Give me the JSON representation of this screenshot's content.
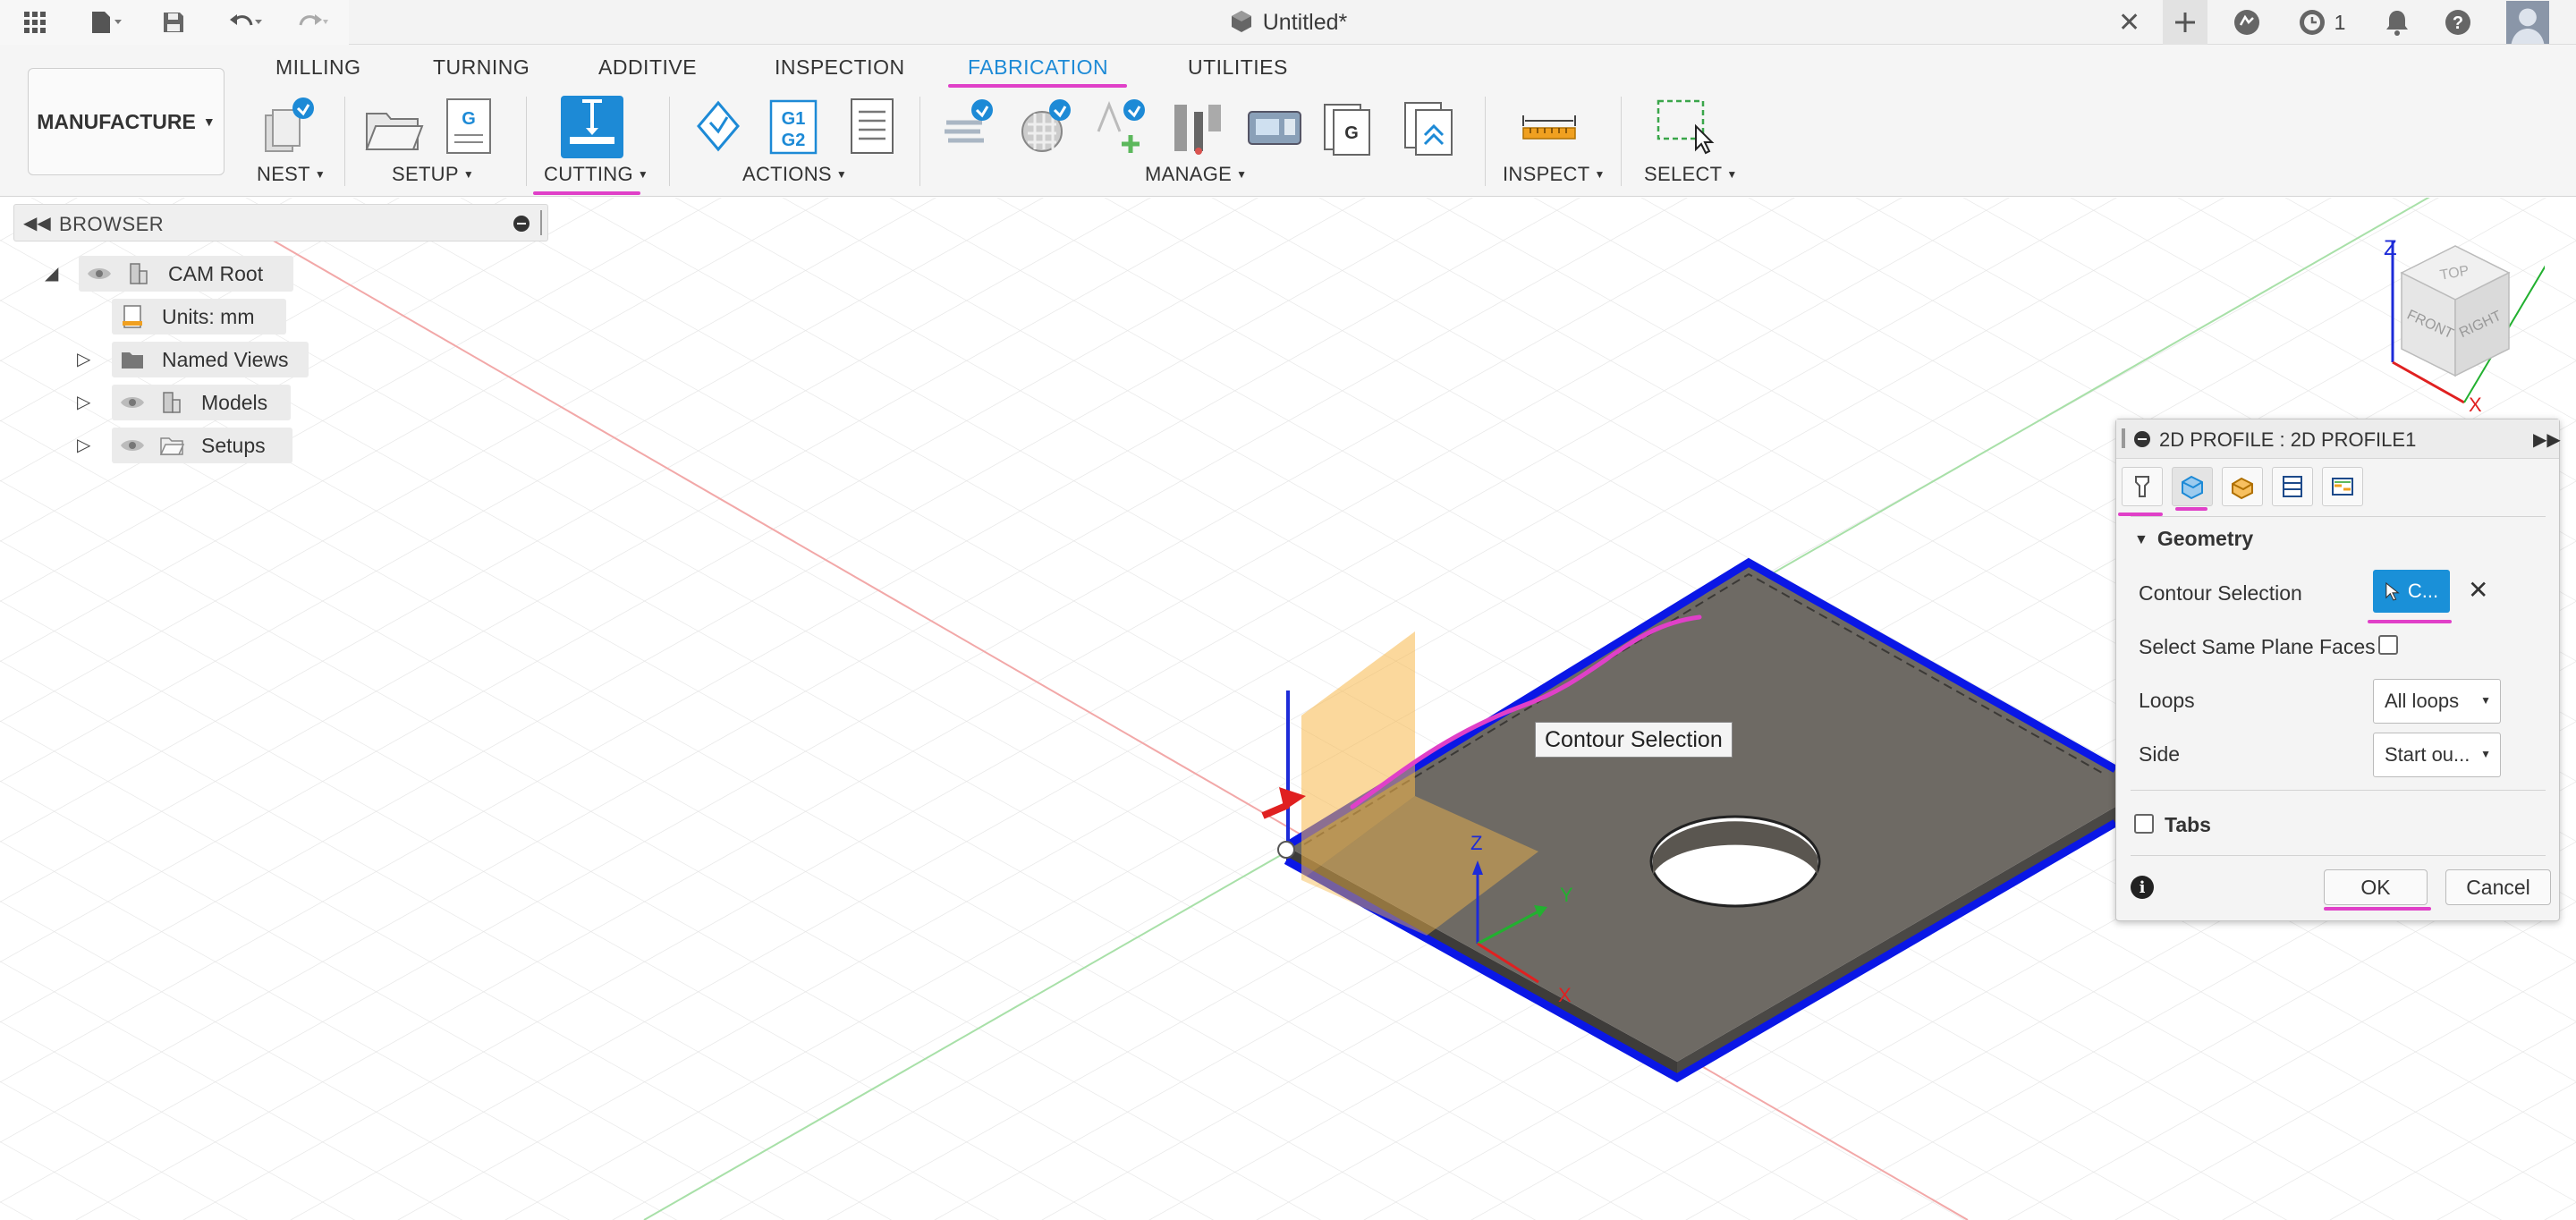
{
  "titlebar": {
    "document_title": "Untitled*",
    "notification_count": "1"
  },
  "ribbon": {
    "workspace": "MANUFACTURE",
    "tabs": [
      "MILLING",
      "TURNING",
      "ADDITIVE",
      "INSPECTION",
      "FABRICATION",
      "UTILITIES"
    ],
    "active_tab": "FABRICATION",
    "groups": {
      "nest": "NEST",
      "setup": "SETUP",
      "cutting": "CUTTING",
      "actions": "ACTIONS",
      "manage": "MANAGE",
      "inspect": "INSPECT",
      "select": "SELECT"
    },
    "nc_icon_text_1": "G1",
    "nc_icon_text_2": "G2",
    "g_icon_text": "G"
  },
  "browser": {
    "title": "BROWSER",
    "items": [
      {
        "label": "CAM Root"
      },
      {
        "label": "Units: mm"
      },
      {
        "label": "Named Views"
      },
      {
        "label": "Models"
      },
      {
        "label": "Setups"
      }
    ]
  },
  "viewport": {
    "tooltip": "Contour Selection",
    "axis_labels": {
      "x": "X",
      "y": "Y",
      "z": "Z"
    },
    "viewcube": {
      "top": "TOP",
      "front": "FRONT",
      "right": "RIGHT",
      "z": "Z",
      "x": "X"
    }
  },
  "dialog": {
    "title": "2D PROFILE : 2D PROFILE1",
    "section_geometry": "Geometry",
    "contour_selection_label": "Contour Selection",
    "contour_selection_value": "C...",
    "same_plane_label": "Select Same Plane Faces",
    "loops_label": "Loops",
    "loops_value": "All loops",
    "side_label": "Side",
    "side_value": "Start ou...",
    "section_tabs": "Tabs",
    "ok": "OK",
    "cancel": "Cancel"
  },
  "colors": {
    "accent": "#1d8ad6",
    "annotation": "#e040c8",
    "selection_edge": "#0a17e6",
    "part_face": "#6e6a64"
  }
}
